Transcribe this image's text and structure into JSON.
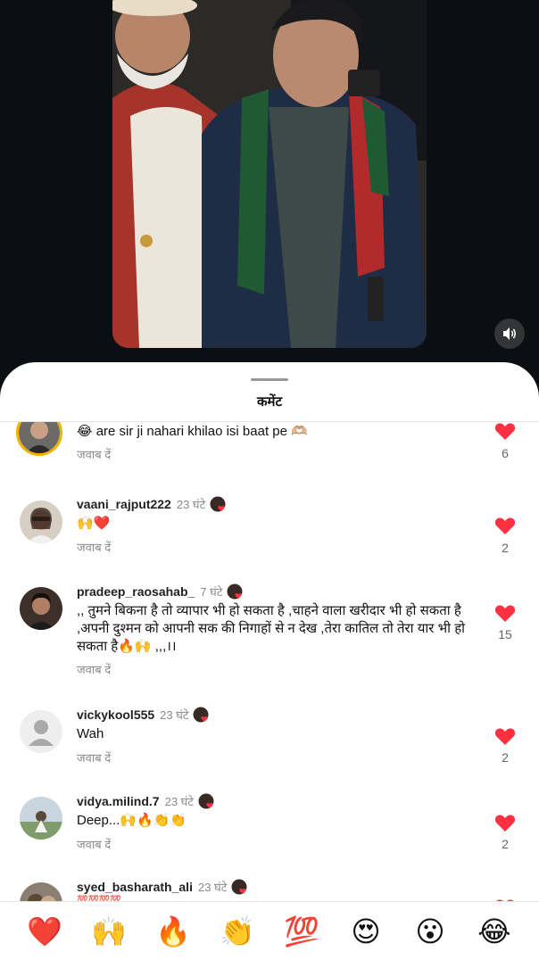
{
  "sheet": {
    "title": "कमेंट"
  },
  "comments": [
    {
      "username": "",
      "time": "",
      "text": "😂 are sir ji nahari khilao isi baat pe 🫶🏼",
      "reply_label": "जवाब दें",
      "likes": "6"
    },
    {
      "username": "vaani_rajput222",
      "time": "23 घंटे",
      "text": "🙌❤️",
      "reply_label": "जवाब दें",
      "likes": "2"
    },
    {
      "username": "pradeep_raosahab_",
      "time": "7 घंटे",
      "text": ",, तुमने बिकना है तो व्यापार भी हो सकता है ,चाहने वाला खरीदार भी हो सकता है ,अपनी दुश्मन को आपनी सक की निगाहों से न देख ,तेरा कातिल तो तेरा यार भी हो सकता है🔥🙌 ,,,।।",
      "reply_label": "जवाब दें",
      "likes": "15"
    },
    {
      "username": "vickykool555",
      "time": "23 घंटे",
      "text": "Wah",
      "reply_label": "जवाब दें",
      "likes": "2"
    },
    {
      "username": "vidya.milind.7",
      "time": "23 घंटे",
      "text": "Deep...🙌🔥👏👏",
      "reply_label": "जवाब दें",
      "likes": "2"
    },
    {
      "username": "syed_basharath_ali",
      "time": "23 घंटे",
      "text": "💯💯💯💯",
      "reply_label": "",
      "likes": ""
    }
  ],
  "emoji_bar": [
    "❤️",
    "🙌",
    "🔥",
    "👏",
    "💯",
    "😍",
    "😮",
    "😂"
  ],
  "colors": {
    "like": "#ff3040",
    "story_ring": "#f0b400",
    "background_dark": "#0b0f14"
  }
}
